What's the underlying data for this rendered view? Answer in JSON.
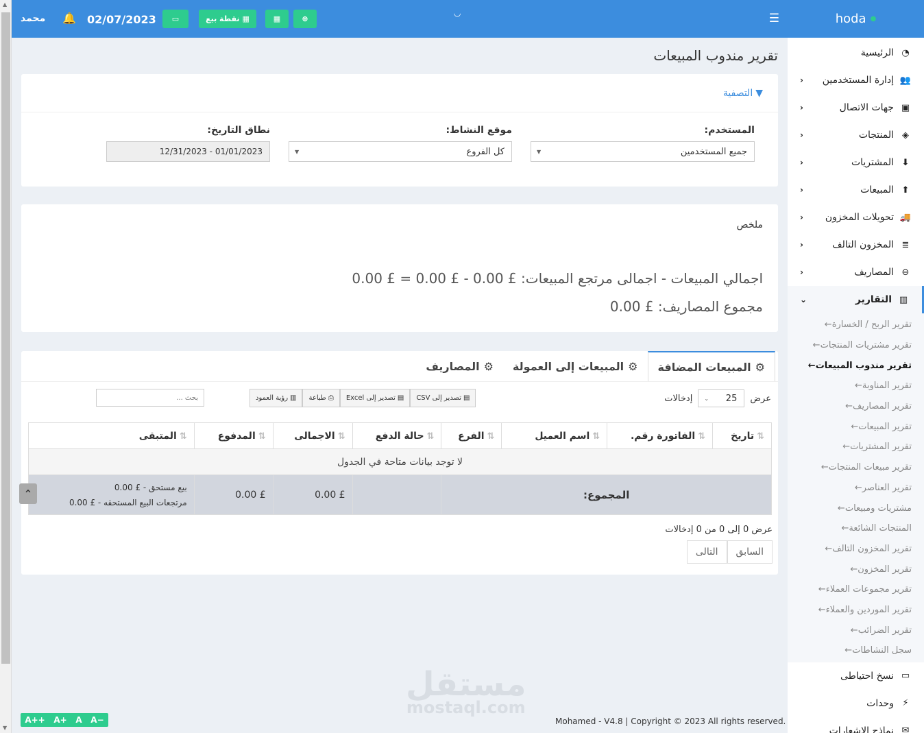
{
  "header": {
    "user": "محمد",
    "date": "02/07/2023",
    "pos_button": "نقطة بيع",
    "icons": [
      "bell-icon",
      "money-icon",
      "pos-icon",
      "calculator-icon",
      "plus-circle-icon",
      "menu-icon"
    ]
  },
  "sidebar": {
    "brand": "hoda",
    "items": [
      {
        "label": "الرئيسية",
        "icon": "dashboard-icon",
        "chevron": false
      },
      {
        "label": "إدارة المستخدمين",
        "icon": "users-icon",
        "chevron": true
      },
      {
        "label": "جهات الاتصال",
        "icon": "contacts-icon",
        "chevron": true
      },
      {
        "label": "المنتجات",
        "icon": "cubes-icon",
        "chevron": true
      },
      {
        "label": "المشتريات",
        "icon": "arrow-down-circle-icon",
        "chevron": true
      },
      {
        "label": "المبيعات",
        "icon": "arrow-up-circle-icon",
        "chevron": true
      },
      {
        "label": "تحويلات المخزون",
        "icon": "truck-icon",
        "chevron": true
      },
      {
        "label": "المخزون التالف",
        "icon": "database-icon",
        "chevron": true
      },
      {
        "label": "المصاريف",
        "icon": "minus-circle-icon",
        "chevron": true
      },
      {
        "label": "التقارير",
        "icon": "chart-icon",
        "chevron": true
      }
    ],
    "report_items": [
      "تقرير الربح / الخسارة",
      "تقرير مشتريات المنتجات",
      "تقرير مندوب المبيعات",
      "تقرير المناوبة",
      "تقرير المصاريف",
      "تقرير المبيعات",
      "تقرير المشتريات",
      "تقرير مبيعات المنتجات",
      "تقرير العناصر",
      "مشتريات ومبيعات",
      "المنتجات الشائعة",
      "تقرير المخزون التالف",
      "تقرير المخزون",
      "تقرير مجموعات العملاء",
      "تقرير الموردين والعملاء",
      "تقرير الضرائب",
      "سجل النشاطات"
    ],
    "active_report_index": 2,
    "bottom_items": [
      {
        "label": "نسخ احتياطى",
        "icon": "hdd-icon"
      },
      {
        "label": "وحدات",
        "icon": "plug-icon"
      },
      {
        "label": "نماذج الإشعارات",
        "icon": "envelope-icon"
      }
    ]
  },
  "page": {
    "title": "تقرير مندوب المبيعات",
    "filter": {
      "heading": "التصفية",
      "user_label": "المستخدم:",
      "user_value": "جميع المستخدمين",
      "location_label": "موقع النشاط:",
      "location_value": "كل الفروع",
      "date_label": "نطاق التاريخ:",
      "date_value": "01/01/2023 - 12/31/2023"
    },
    "summary": {
      "title": "ملخص",
      "line1": "اجمالي المبيعات - اجمالى مرتجع المبيعات: £ 0.00 - £ 0.00 = £ 0.00",
      "line2": "مجموع المصاريف: £ 0.00"
    },
    "tabs": [
      "المبيعات المضافة",
      "المبيعات إلى العمولة",
      "المصاريف"
    ],
    "table_controls": {
      "show_label": "عرض",
      "entries_value": "25",
      "entries_label": "إدخالات",
      "export_csv": "تصدير إلى CSV",
      "export_excel": "تصدير إلى Excel",
      "print": "طباعة",
      "column_visibility": "رؤية العمود",
      "search_placeholder": "بحث ..."
    },
    "table": {
      "columns": [
        "تاريخ",
        "الفاتورة رقم.",
        "اسم العميل",
        "الفرع",
        "حالة الدفع",
        "الاجمالى",
        "المدفوع",
        "المتبقى"
      ],
      "empty_message": "لا توجد بيانات متاحة في الجدول",
      "total_label": "المجموع:",
      "total_amount": "£ 0.00",
      "paid_amount": "£ 0.00",
      "due_sell": "بيع مستحق - £ 0.00",
      "due_return": "مرتجعات البيع المستحقه - £ 0.00"
    },
    "info": "عرض 0 إلى 0 من 0 إدخالات",
    "pager": {
      "prev": "السابق",
      "next": "التالى"
    }
  },
  "footer": "Mohamed - V4.8 | Copyright © 2023 All rights reserved.",
  "watermark": {
    "arabic": "مستقل",
    "latin": "mostaql.com"
  },
  "font_controls": [
    "A++",
    "A+",
    "A",
    "A−"
  ],
  "colors": {
    "primary": "#3c8dde",
    "green": "#2ecc8e",
    "total_row": "#d2d6de"
  }
}
